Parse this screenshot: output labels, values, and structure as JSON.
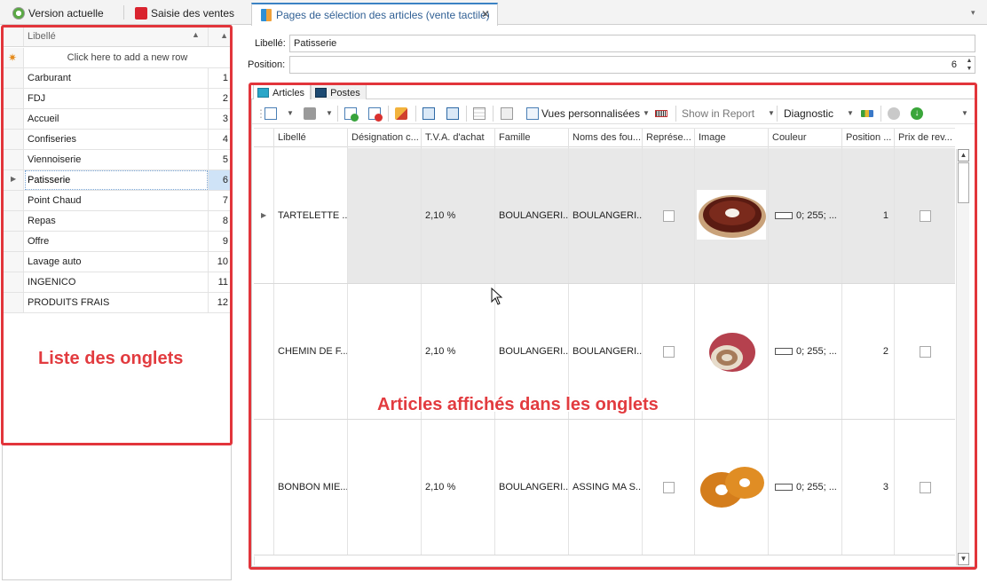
{
  "top_tabs": {
    "version": "Version actuelle",
    "saisie": "Saisie des ventes"
  },
  "left_grid": {
    "header": "Libellé",
    "add_row": "Click here to add a new row",
    "rows": [
      {
        "label": "Carburant",
        "pos": "1"
      },
      {
        "label": "FDJ",
        "pos": "2"
      },
      {
        "label": "Accueil",
        "pos": "3"
      },
      {
        "label": "Confiseries",
        "pos": "4"
      },
      {
        "label": "Viennoiserie",
        "pos": "5"
      },
      {
        "label": "Patisserie",
        "pos": "6"
      },
      {
        "label": "Point Chaud",
        "pos": "7"
      },
      {
        "label": "Repas",
        "pos": "8"
      },
      {
        "label": "Offre",
        "pos": "9"
      },
      {
        "label": "Lavage auto",
        "pos": "10"
      },
      {
        "label": "INGENICO",
        "pos": "11"
      },
      {
        "label": "PRODUITS FRAIS",
        "pos": "12"
      }
    ]
  },
  "doc_tab": {
    "title": "Pages de sélection des articles (vente tactile)"
  },
  "form": {
    "libelle_label": "Libellé:",
    "libelle_value": "Patisserie",
    "position_label": "Position:",
    "position_value": "6"
  },
  "inner_tabs": {
    "articles": "Articles",
    "postes": "Postes"
  },
  "toolbar": {
    "views": "Vues personnalisées",
    "show_report": "Show in Report",
    "diagnostic": "Diagnostic"
  },
  "articles_grid": {
    "columns": [
      "Libellé",
      "Désignation c...",
      "T.V.A. d'achat",
      "Famille",
      "Noms des fou...",
      "Représe...",
      "Image",
      "Couleur",
      "Position ...",
      "Prix de rev..."
    ],
    "rows": [
      {
        "libelle": "TARTELETTE ...",
        "tva": "2,10 %",
        "famille": "BOULANGERI...",
        "fournisseur": "BOULANGERI...",
        "couleur": "0; 255; ...",
        "position": "1",
        "image": "tartelette-image"
      },
      {
        "libelle": "CHEMIN DE F...",
        "tva": "2,10 %",
        "famille": "BOULANGERI...",
        "fournisseur": "BOULANGERI...",
        "couleur": "0; 255; ...",
        "position": "2",
        "image": "roll-cake-image"
      },
      {
        "libelle": "BONBON MIE...",
        "tva": "2,10 %",
        "famille": "BOULANGERI...",
        "fournisseur": "ASSING MA S...",
        "couleur": "0; 255; ...",
        "position": "3",
        "image": "donut-image"
      }
    ]
  },
  "annotations": {
    "left": "Liste des onglets",
    "right": "Articles affichés dans les onglets"
  },
  "colors": {
    "annotation_red": "#e2353b",
    "accent_blue": "#3b82c4",
    "selected_cell": "#cfe3f7",
    "highlight_row": "#e8e8e8"
  }
}
